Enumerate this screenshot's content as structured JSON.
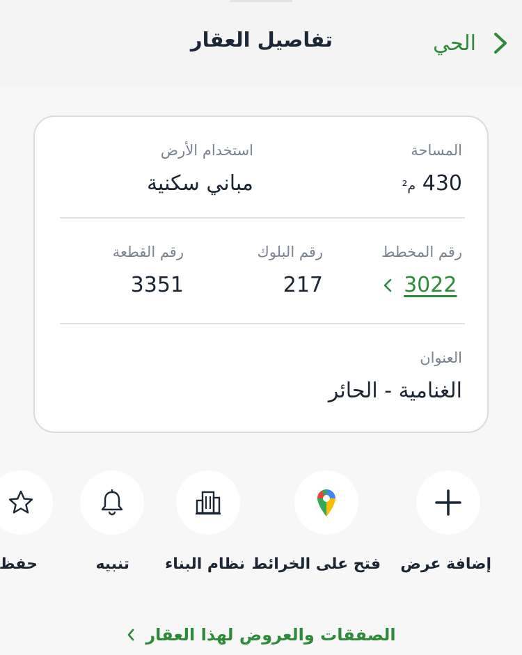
{
  "header": {
    "back_label": "الحي",
    "title": "تفاصيل العقار"
  },
  "card": {
    "area": {
      "label": "المساحة",
      "value": "430",
      "unit": "م²"
    },
    "land_use": {
      "label": "استخدام الأرض",
      "value": "مباني سكنية"
    },
    "plan": {
      "label": "رقم المخطط",
      "value": "3022"
    },
    "block": {
      "label": "رقم البلوك",
      "value": "217"
    },
    "plot": {
      "label": "رقم القطعة",
      "value": "3351"
    },
    "address": {
      "label": "العنوان",
      "value": "الغنامية - الحائر"
    }
  },
  "actions": [
    {
      "label": "إضافة عرض",
      "icon": "plus-icon"
    },
    {
      "label": "فتح على الخرائط",
      "icon": "map-pin-icon"
    },
    {
      "label": "نظام البناء",
      "icon": "building-icon"
    },
    {
      "label": "تنبيه",
      "icon": "bell-icon"
    },
    {
      "label": "حفظ",
      "icon": "star-icon"
    }
  ],
  "footer": {
    "link_label": "الصفقات والعروض لهذا العقار"
  },
  "colors": {
    "accent": "#2e8b3a",
    "text": "#1c2633",
    "muted": "#7a8291",
    "card_border": "#d9dbdf"
  }
}
